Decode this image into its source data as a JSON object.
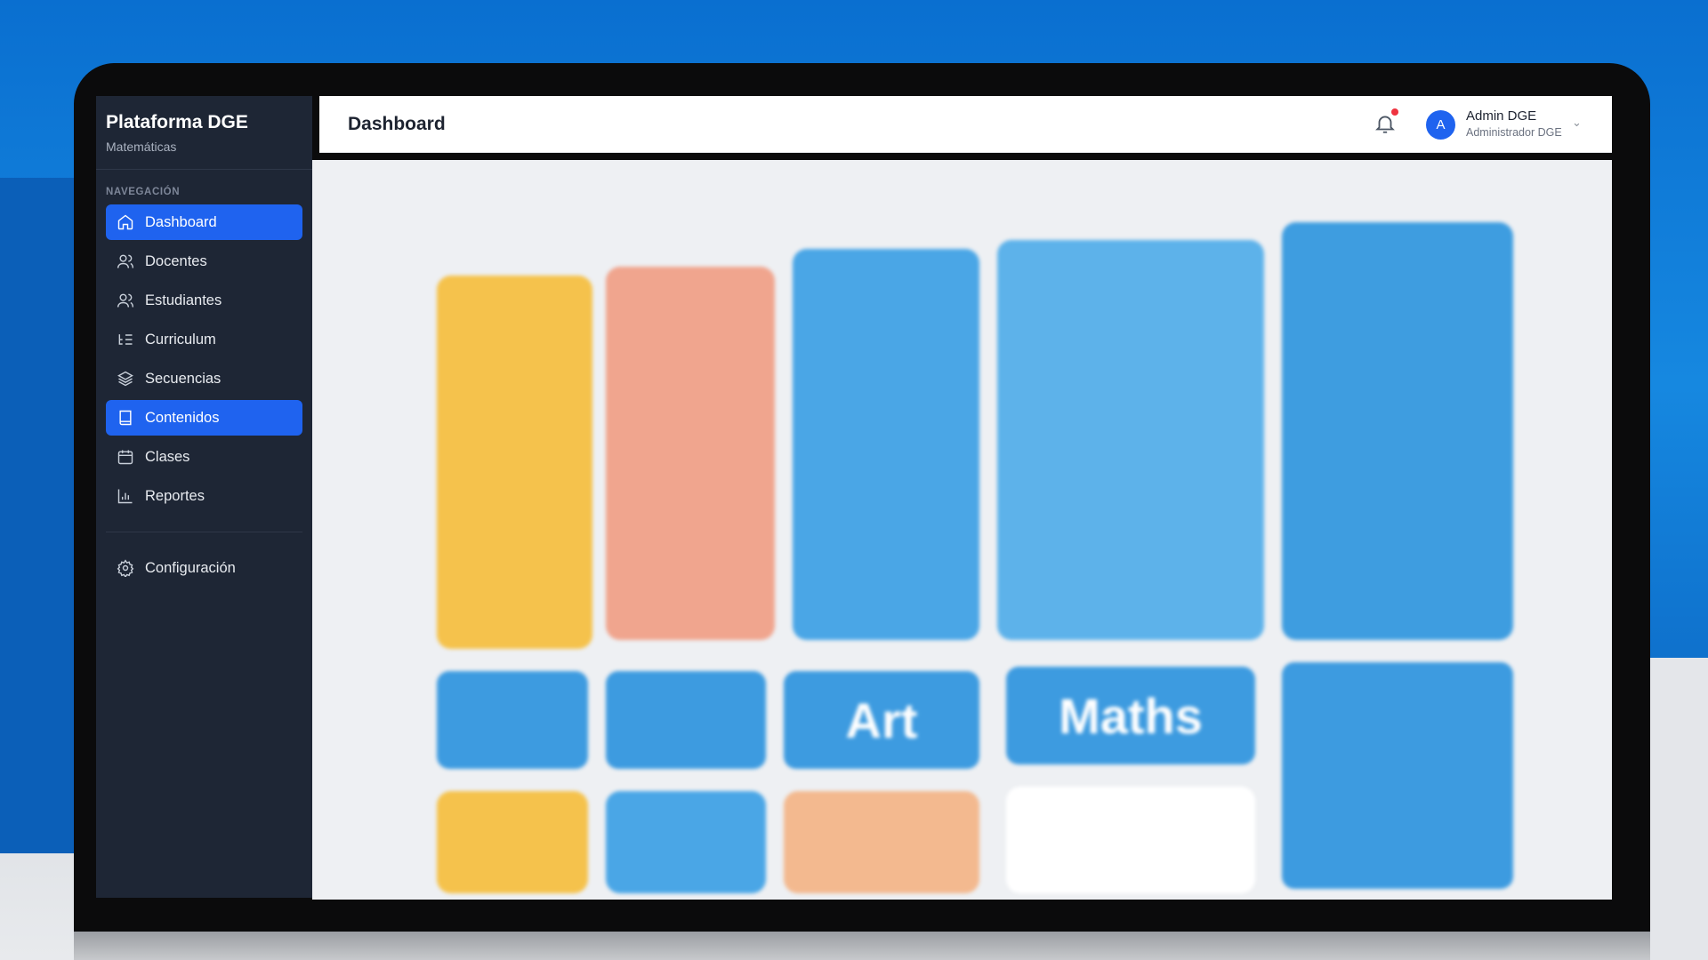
{
  "sidebar": {
    "brand_title": "Plataforma DGE",
    "brand_subtitle": "Matemáticas",
    "nav_label": "NAVEGACIÓN",
    "items": [
      {
        "label": "Dashboard",
        "icon": "home-icon",
        "active": true
      },
      {
        "label": "Docentes",
        "icon": "users-icon",
        "active": false
      },
      {
        "label": "Estudiantes",
        "icon": "users-icon",
        "active": false
      },
      {
        "label": "Curriculum",
        "icon": "list-tree-icon",
        "active": false
      },
      {
        "label": "Secuencias",
        "icon": "layers-icon",
        "active": false
      },
      {
        "label": "Contenidos",
        "icon": "book-icon",
        "active": true
      },
      {
        "label": "Clases",
        "icon": "calendar-icon",
        "active": false
      },
      {
        "label": "Reportes",
        "icon": "bar-chart-icon",
        "active": false
      }
    ],
    "settings_label": "Configuración"
  },
  "header": {
    "title": "Dashboard",
    "notification_dot": true,
    "user": {
      "initial": "A",
      "name": "Admin DGE",
      "role": "Administrador DGE"
    }
  },
  "content": {
    "tiles": [
      "Art",
      "Maths"
    ]
  },
  "colors": {
    "accent": "#1f63ef",
    "sidebar_bg": "#1e2635",
    "notification": "#ef3340"
  }
}
